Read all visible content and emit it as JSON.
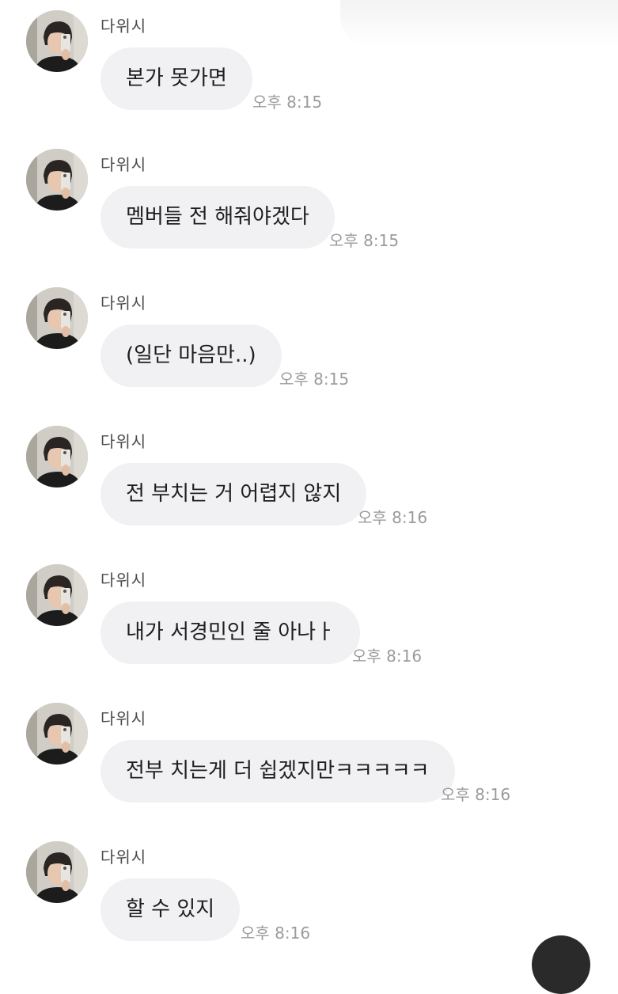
{
  "sender_name": "다위시",
  "messages": [
    {
      "text": "본가 못가면",
      "time": "오후 8:15"
    },
    {
      "text": "멤버들 전 해줘야겠다",
      "time": "오후 8:15"
    },
    {
      "text": "(일단 마음만..)",
      "time": "오후 8:15"
    },
    {
      "text": "전 부치는 거 어렵지 않지",
      "time": "오후 8:16"
    },
    {
      "text": "내가 서경민인 줄 아나ㅏ",
      "time": "오후 8:16"
    },
    {
      "text": "전부 치는게 더 쉽겠지만ㅋㅋㅋㅋㅋ",
      "time": "오후 8:16"
    },
    {
      "text": "할 수 있지",
      "time": "오후 8:16"
    }
  ]
}
